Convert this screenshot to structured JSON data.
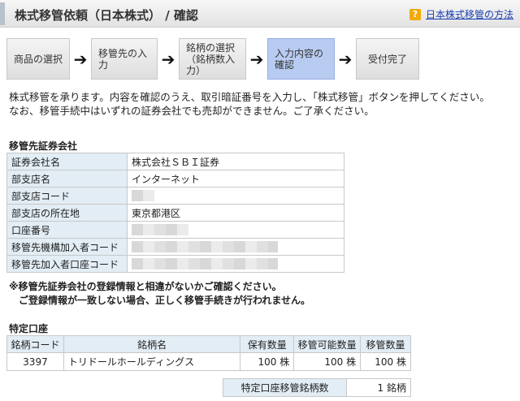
{
  "header": {
    "title": "株式移管依頼（日本株式） / 確認",
    "help_icon": "question-icon",
    "help_link": "日本株式移管の方法"
  },
  "steps": [
    {
      "label": "商品の選択"
    },
    {
      "label": "移管先の入力"
    },
    {
      "label": "銘柄の選択\n（銘柄数入力）"
    },
    {
      "label": "入力内容の\n確認"
    },
    {
      "label": "受付完了"
    }
  ],
  "intro": {
    "line1": "株式移管を承ります。内容を確認のうえ、取引暗証番号を入力し、「株式移管」ボタンを押してください。",
    "line2": "なお、移管手続中はいずれの証券会社でも売却ができません。ご了承ください。"
  },
  "broker": {
    "section_title": "移管先証券会社",
    "rows": [
      {
        "label": "証券会社名",
        "value": "株式会社ＳＢＩ証券"
      },
      {
        "label": "部支店名",
        "value": "インターネット"
      },
      {
        "label": "部支店コード",
        "value": ""
      },
      {
        "label": "部支店の所在地",
        "value": "東京都港区"
      },
      {
        "label": "口座番号",
        "value": ""
      },
      {
        "label": "移管先機構加入者コード",
        "value": ""
      },
      {
        "label": "移管先加入者口座コード",
        "value": ""
      }
    ]
  },
  "notes": {
    "line1": "※移管先証券会社の登録情報と相違がないかご確認ください。",
    "line2": "　ご登録情報が一致しない場合、正しく移管手続きが行われません。"
  },
  "holdings": {
    "section_title": "特定口座",
    "headers": [
      "銘柄コード",
      "銘柄名",
      "保有数量",
      "移管可能数量",
      "移管数量"
    ],
    "rows": [
      {
        "code": "3397",
        "name": "トリドールホールディングス",
        "held": "100 株",
        "transferable": "100 株",
        "transfer": "100 株"
      }
    ],
    "total_label": "特定口座移管銘柄数",
    "total_value": "1 銘柄"
  },
  "colors": {
    "label_bg": "#e2edf5",
    "active_step": "#b8ccf2",
    "link": "#1a3fb0",
    "help_icon": "#f2a900"
  }
}
